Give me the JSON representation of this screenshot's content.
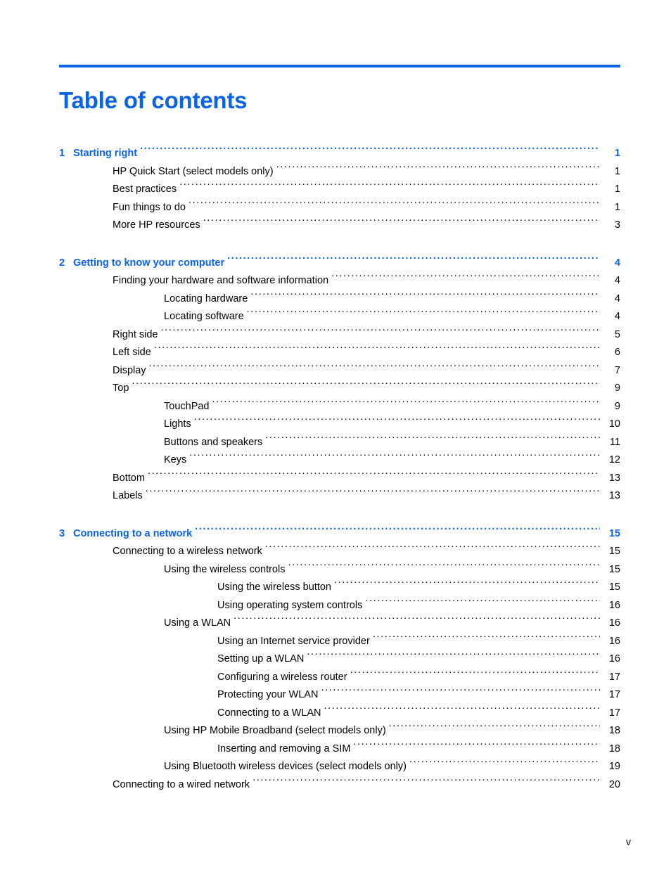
{
  "document": {
    "page_title": "Table of contents",
    "folio": "v",
    "accent_color": "#0B63E5",
    "text_color": "#000000",
    "background_color": "#FFFFFF"
  },
  "toc": {
    "entries": [
      {
        "level": "chapter",
        "number": "1",
        "label": "Starting right",
        "page": "1"
      },
      {
        "level": "lvl1",
        "number": "",
        "label": "HP Quick Start (select models only)",
        "page": "1"
      },
      {
        "level": "lvl1",
        "number": "",
        "label": "Best practices",
        "page": "1"
      },
      {
        "level": "lvl1",
        "number": "",
        "label": "Fun things to do",
        "page": "1"
      },
      {
        "level": "lvl1",
        "number": "",
        "label": "More HP resources",
        "page": "3"
      },
      {
        "level": "chapter",
        "number": "2",
        "label": "Getting to know your computer",
        "page": "4"
      },
      {
        "level": "lvl1",
        "number": "",
        "label": "Finding your hardware and software information",
        "page": "4"
      },
      {
        "level": "lvl2",
        "number": "",
        "label": "Locating hardware",
        "page": "4"
      },
      {
        "level": "lvl2",
        "number": "",
        "label": "Locating software",
        "page": "4"
      },
      {
        "level": "lvl1",
        "number": "",
        "label": "Right side",
        "page": "5"
      },
      {
        "level": "lvl1",
        "number": "",
        "label": "Left side",
        "page": "6"
      },
      {
        "level": "lvl1",
        "number": "",
        "label": "Display",
        "page": "7"
      },
      {
        "level": "lvl1",
        "number": "",
        "label": "Top",
        "page": "9"
      },
      {
        "level": "lvl2",
        "number": "",
        "label": "TouchPad",
        "page": "9"
      },
      {
        "level": "lvl2",
        "number": "",
        "label": "Lights",
        "page": "10"
      },
      {
        "level": "lvl2",
        "number": "",
        "label": "Buttons and speakers",
        "page": "11"
      },
      {
        "level": "lvl2",
        "number": "",
        "label": "Keys",
        "page": "12"
      },
      {
        "level": "lvl1",
        "number": "",
        "label": "Bottom",
        "page": "13"
      },
      {
        "level": "lvl1",
        "number": "",
        "label": "Labels",
        "page": "13"
      },
      {
        "level": "chapter",
        "number": "3",
        "label": "Connecting to a network",
        "page": "15"
      },
      {
        "level": "lvl1",
        "number": "",
        "label": "Connecting to a wireless network",
        "page": "15"
      },
      {
        "level": "lvl2",
        "number": "",
        "label": "Using the wireless controls",
        "page": "15"
      },
      {
        "level": "lvl3",
        "number": "",
        "label": "Using the wireless button",
        "page": "15"
      },
      {
        "level": "lvl3",
        "number": "",
        "label": "Using operating system controls",
        "page": "16"
      },
      {
        "level": "lvl2",
        "number": "",
        "label": "Using a WLAN",
        "page": "16"
      },
      {
        "level": "lvl3",
        "number": "",
        "label": "Using an Internet service provider",
        "page": "16"
      },
      {
        "level": "lvl3",
        "number": "",
        "label": "Setting up a WLAN",
        "page": "16"
      },
      {
        "level": "lvl3",
        "number": "",
        "label": "Configuring a wireless router",
        "page": "17"
      },
      {
        "level": "lvl3",
        "number": "",
        "label": "Protecting your WLAN",
        "page": "17"
      },
      {
        "level": "lvl3",
        "number": "",
        "label": "Connecting to a WLAN",
        "page": "17"
      },
      {
        "level": "lvl2",
        "number": "",
        "label": "Using HP Mobile Broadband (select models only)",
        "page": "18"
      },
      {
        "level": "lvl3",
        "number": "",
        "label": "Inserting and removing a SIM",
        "page": "18"
      },
      {
        "level": "lvl2",
        "number": "",
        "label": "Using Bluetooth wireless devices (select models only)",
        "page": "19"
      },
      {
        "level": "lvl1",
        "number": "",
        "label": "Connecting to a wired network",
        "page": "20"
      }
    ]
  }
}
